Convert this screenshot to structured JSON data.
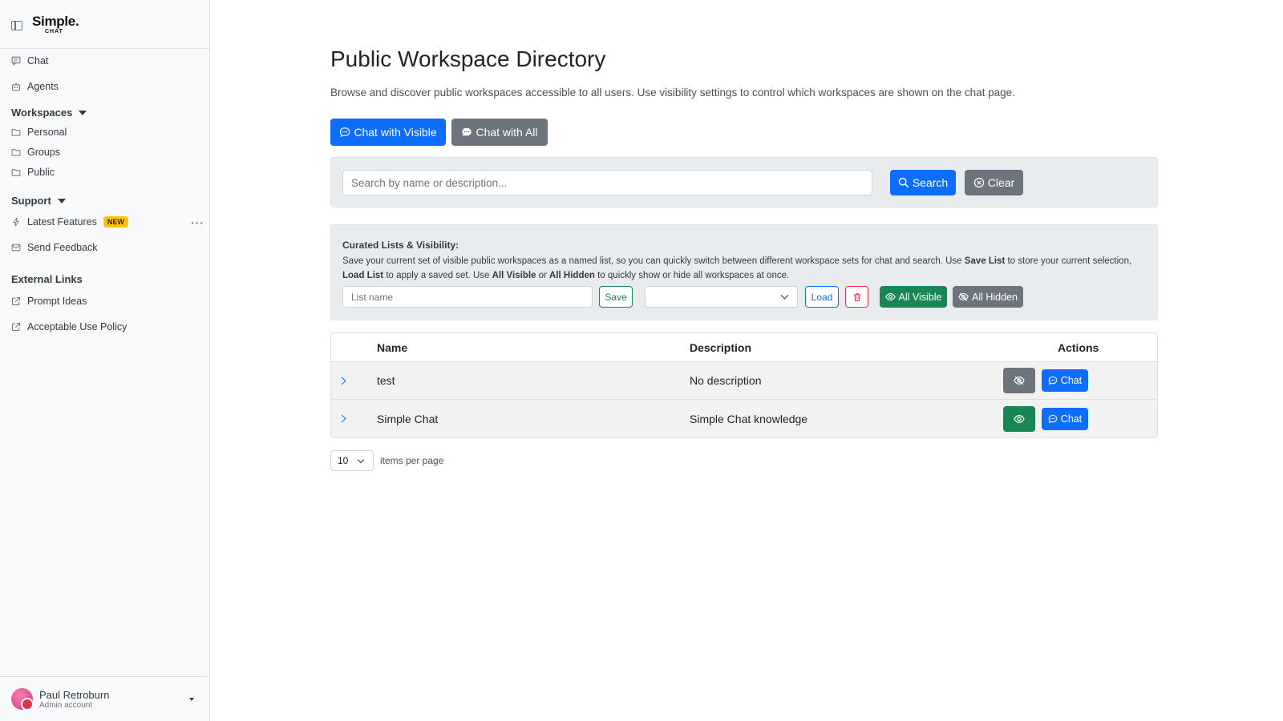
{
  "sidebar": {
    "logo_main": "Simple.",
    "logo_sub": "CHAT",
    "nav": [
      {
        "label": "Chat",
        "icon": "chat-square-icon"
      },
      {
        "label": "Agents",
        "icon": "robot-icon"
      }
    ],
    "workspaces_label": "Workspaces",
    "workspaces": [
      {
        "label": "Personal",
        "icon": "folder-icon"
      },
      {
        "label": "Groups",
        "icon": "folder-icon"
      },
      {
        "label": "Public",
        "icon": "folder-icon"
      }
    ],
    "support_label": "Support",
    "support": [
      {
        "label": "Latest Features",
        "icon": "lightning-icon",
        "badge": "NEW"
      },
      {
        "label": "Send Feedback",
        "icon": "envelope-icon"
      }
    ],
    "external_label": "External Links",
    "external": [
      {
        "label": "Prompt Ideas",
        "icon": "external-link-icon"
      },
      {
        "label": "Acceptable Use Policy",
        "icon": "external-link-icon"
      }
    ],
    "more": "···",
    "user": {
      "name": "Paul Retroburn",
      "role": "Admin account"
    }
  },
  "main": {
    "title": "Public Workspace Directory",
    "description": "Browse and discover public workspaces accessible to all users. Use visibility settings to control which workspaces are shown on the chat page.",
    "chat_visible_label": "Chat with Visible",
    "chat_all_label": "Chat with All",
    "search": {
      "placeholder": "Search by name or description...",
      "search_label": "Search",
      "clear_label": "Clear"
    },
    "curated": {
      "title": "Curated Lists & Visibility:",
      "t1": "Save your current set of visible public workspaces as a named list, so you can quickly switch between different workspace sets for chat and search. Use ",
      "b1": "Save List",
      "t2": " to store your current selection, ",
      "b2": "Load List",
      "t3": " to apply a saved set. Use ",
      "b3": "All Visible",
      "t4": " or ",
      "b4": "All Hidden",
      "t5": " to quickly show or hide all workspaces at once.",
      "list_placeholder": "List name",
      "save_label": "Save",
      "load_label": "Load",
      "all_visible_label": "All Visible",
      "all_hidden_label": "All Hidden"
    },
    "table": {
      "headers": {
        "name": "Name",
        "description": "Description",
        "actions": "Actions"
      },
      "rows": [
        {
          "name": "test",
          "description": "No description",
          "visible": false,
          "chat_label": "Chat"
        },
        {
          "name": "Simple Chat",
          "description": "Simple Chat knowledge",
          "visible": true,
          "chat_label": "Chat"
        }
      ]
    },
    "pager": {
      "per_page": "10",
      "label": "items per page"
    }
  },
  "colors": {
    "primary": "#0d6efd",
    "secondary": "#6c757d",
    "success": "#198754",
    "danger": "#dc3545",
    "warning": "#ffc107"
  }
}
